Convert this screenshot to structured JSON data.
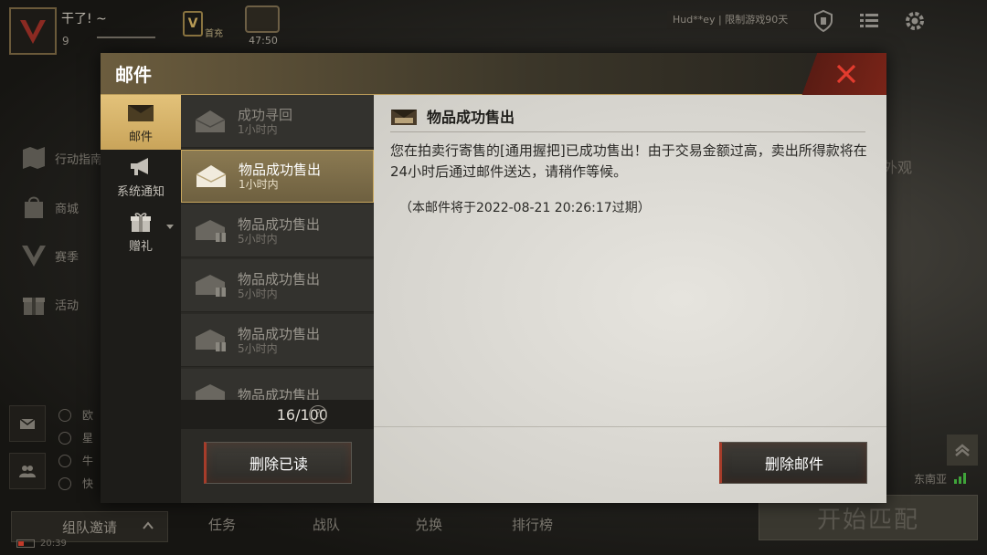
{
  "background": {
    "player": {
      "name": "干了! ~",
      "level": "9"
    },
    "first_charge_label": "首充",
    "timer": "47:50",
    "limit_notice": "Hud**ey | 限制游戏90天",
    "side_menu": [
      {
        "label": "行动指南",
        "icon": "map-icon"
      },
      {
        "label": "商城",
        "icon": "shop-bag-icon"
      },
      {
        "label": "赛季",
        "icon": "season-v-icon"
      },
      {
        "label": "活动",
        "icon": "gift-icon"
      }
    ],
    "friends": [
      "欧",
      "星",
      "牛",
      "快"
    ],
    "team_invite": "组队邀请",
    "nav_tabs": [
      "任务",
      "战队",
      "兑换",
      "排行榜"
    ],
    "clock": "20:39",
    "appearance_text": "外观",
    "region": "东南亚",
    "start_match": "开始匹配"
  },
  "dialog": {
    "title": "邮件",
    "categories": [
      {
        "label": "邮件",
        "icon": "mail-envelope-icon",
        "active": true
      },
      {
        "label": "系统通知",
        "icon": "megaphone-icon",
        "active": false
      },
      {
        "label": "赠礼",
        "icon": "gift-icon",
        "active": false
      }
    ],
    "mail_list": [
      {
        "subject": "成功寻回",
        "time": "1小时内",
        "selected": false
      },
      {
        "subject": "物品成功售出",
        "time": "1小时内",
        "selected": true
      },
      {
        "subject": "物品成功售出",
        "time": "5小时内",
        "selected": false
      },
      {
        "subject": "物品成功售出",
        "time": "5小时内",
        "selected": false
      },
      {
        "subject": "物品成功售出",
        "time": "5小时内",
        "selected": false
      },
      {
        "subject": "物品成功售出",
        "time": "",
        "selected": false
      }
    ],
    "mail_count": "16/100",
    "help_symbol": "?",
    "delete_read_label": "删除已读",
    "content": {
      "title": "物品成功售出",
      "body": "您在拍卖行寄售的[通用握把]已成功售出！由于交易金额过高，卖出所得款将在24小时后通过邮件送达，请稍作等候。",
      "expire": "（本邮件将于2022-08-21 20:26:17过期）"
    },
    "delete_mail_label": "删除邮件"
  },
  "colors": {
    "accent_gold": "#c9a45a",
    "close_red": "#e33b2e",
    "dialog_bg": "#23221f",
    "content_bg": "#e6e4de"
  }
}
